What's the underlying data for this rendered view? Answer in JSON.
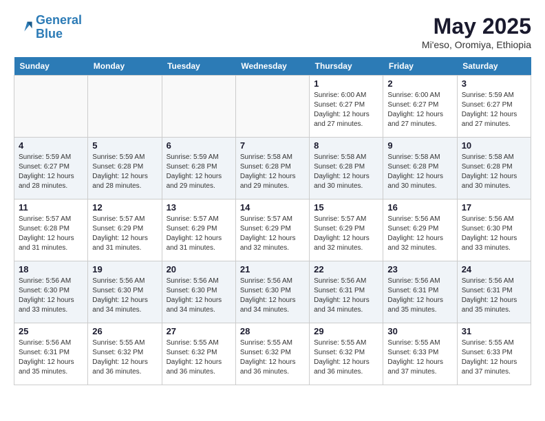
{
  "logo": {
    "line1": "General",
    "line2": "Blue"
  },
  "title": "May 2025",
  "subtitle": "Mi'eso, Oromiya, Ethiopia",
  "days_of_week": [
    "Sunday",
    "Monday",
    "Tuesday",
    "Wednesday",
    "Thursday",
    "Friday",
    "Saturday"
  ],
  "weeks": [
    [
      {
        "day": "",
        "sunrise": "",
        "sunset": "",
        "daylight": ""
      },
      {
        "day": "",
        "sunrise": "",
        "sunset": "",
        "daylight": ""
      },
      {
        "day": "",
        "sunrise": "",
        "sunset": "",
        "daylight": ""
      },
      {
        "day": "",
        "sunrise": "",
        "sunset": "",
        "daylight": ""
      },
      {
        "day": "1",
        "sunrise": "Sunrise: 6:00 AM",
        "sunset": "Sunset: 6:27 PM",
        "daylight": "Daylight: 12 hours and 27 minutes."
      },
      {
        "day": "2",
        "sunrise": "Sunrise: 6:00 AM",
        "sunset": "Sunset: 6:27 PM",
        "daylight": "Daylight: 12 hours and 27 minutes."
      },
      {
        "day": "3",
        "sunrise": "Sunrise: 5:59 AM",
        "sunset": "Sunset: 6:27 PM",
        "daylight": "Daylight: 12 hours and 27 minutes."
      }
    ],
    [
      {
        "day": "4",
        "sunrise": "Sunrise: 5:59 AM",
        "sunset": "Sunset: 6:27 PM",
        "daylight": "Daylight: 12 hours and 28 minutes."
      },
      {
        "day": "5",
        "sunrise": "Sunrise: 5:59 AM",
        "sunset": "Sunset: 6:28 PM",
        "daylight": "Daylight: 12 hours and 28 minutes."
      },
      {
        "day": "6",
        "sunrise": "Sunrise: 5:59 AM",
        "sunset": "Sunset: 6:28 PM",
        "daylight": "Daylight: 12 hours and 29 minutes."
      },
      {
        "day": "7",
        "sunrise": "Sunrise: 5:58 AM",
        "sunset": "Sunset: 6:28 PM",
        "daylight": "Daylight: 12 hours and 29 minutes."
      },
      {
        "day": "8",
        "sunrise": "Sunrise: 5:58 AM",
        "sunset": "Sunset: 6:28 PM",
        "daylight": "Daylight: 12 hours and 30 minutes."
      },
      {
        "day": "9",
        "sunrise": "Sunrise: 5:58 AM",
        "sunset": "Sunset: 6:28 PM",
        "daylight": "Daylight: 12 hours and 30 minutes."
      },
      {
        "day": "10",
        "sunrise": "Sunrise: 5:58 AM",
        "sunset": "Sunset: 6:28 PM",
        "daylight": "Daylight: 12 hours and 30 minutes."
      }
    ],
    [
      {
        "day": "11",
        "sunrise": "Sunrise: 5:57 AM",
        "sunset": "Sunset: 6:28 PM",
        "daylight": "Daylight: 12 hours and 31 minutes."
      },
      {
        "day": "12",
        "sunrise": "Sunrise: 5:57 AM",
        "sunset": "Sunset: 6:29 PM",
        "daylight": "Daylight: 12 hours and 31 minutes."
      },
      {
        "day": "13",
        "sunrise": "Sunrise: 5:57 AM",
        "sunset": "Sunset: 6:29 PM",
        "daylight": "Daylight: 12 hours and 31 minutes."
      },
      {
        "day": "14",
        "sunrise": "Sunrise: 5:57 AM",
        "sunset": "Sunset: 6:29 PM",
        "daylight": "Daylight: 12 hours and 32 minutes."
      },
      {
        "day": "15",
        "sunrise": "Sunrise: 5:57 AM",
        "sunset": "Sunset: 6:29 PM",
        "daylight": "Daylight: 12 hours and 32 minutes."
      },
      {
        "day": "16",
        "sunrise": "Sunrise: 5:56 AM",
        "sunset": "Sunset: 6:29 PM",
        "daylight": "Daylight: 12 hours and 32 minutes."
      },
      {
        "day": "17",
        "sunrise": "Sunrise: 5:56 AM",
        "sunset": "Sunset: 6:30 PM",
        "daylight": "Daylight: 12 hours and 33 minutes."
      }
    ],
    [
      {
        "day": "18",
        "sunrise": "Sunrise: 5:56 AM",
        "sunset": "Sunset: 6:30 PM",
        "daylight": "Daylight: 12 hours and 33 minutes."
      },
      {
        "day": "19",
        "sunrise": "Sunrise: 5:56 AM",
        "sunset": "Sunset: 6:30 PM",
        "daylight": "Daylight: 12 hours and 34 minutes."
      },
      {
        "day": "20",
        "sunrise": "Sunrise: 5:56 AM",
        "sunset": "Sunset: 6:30 PM",
        "daylight": "Daylight: 12 hours and 34 minutes."
      },
      {
        "day": "21",
        "sunrise": "Sunrise: 5:56 AM",
        "sunset": "Sunset: 6:30 PM",
        "daylight": "Daylight: 12 hours and 34 minutes."
      },
      {
        "day": "22",
        "sunrise": "Sunrise: 5:56 AM",
        "sunset": "Sunset: 6:31 PM",
        "daylight": "Daylight: 12 hours and 34 minutes."
      },
      {
        "day": "23",
        "sunrise": "Sunrise: 5:56 AM",
        "sunset": "Sunset: 6:31 PM",
        "daylight": "Daylight: 12 hours and 35 minutes."
      },
      {
        "day": "24",
        "sunrise": "Sunrise: 5:56 AM",
        "sunset": "Sunset: 6:31 PM",
        "daylight": "Daylight: 12 hours and 35 minutes."
      }
    ],
    [
      {
        "day": "25",
        "sunrise": "Sunrise: 5:56 AM",
        "sunset": "Sunset: 6:31 PM",
        "daylight": "Daylight: 12 hours and 35 minutes."
      },
      {
        "day": "26",
        "sunrise": "Sunrise: 5:55 AM",
        "sunset": "Sunset: 6:32 PM",
        "daylight": "Daylight: 12 hours and 36 minutes."
      },
      {
        "day": "27",
        "sunrise": "Sunrise: 5:55 AM",
        "sunset": "Sunset: 6:32 PM",
        "daylight": "Daylight: 12 hours and 36 minutes."
      },
      {
        "day": "28",
        "sunrise": "Sunrise: 5:55 AM",
        "sunset": "Sunset: 6:32 PM",
        "daylight": "Daylight: 12 hours and 36 minutes."
      },
      {
        "day": "29",
        "sunrise": "Sunrise: 5:55 AM",
        "sunset": "Sunset: 6:32 PM",
        "daylight": "Daylight: 12 hours and 36 minutes."
      },
      {
        "day": "30",
        "sunrise": "Sunrise: 5:55 AM",
        "sunset": "Sunset: 6:33 PM",
        "daylight": "Daylight: 12 hours and 37 minutes."
      },
      {
        "day": "31",
        "sunrise": "Sunrise: 5:55 AM",
        "sunset": "Sunset: 6:33 PM",
        "daylight": "Daylight: 12 hours and 37 minutes."
      }
    ]
  ]
}
